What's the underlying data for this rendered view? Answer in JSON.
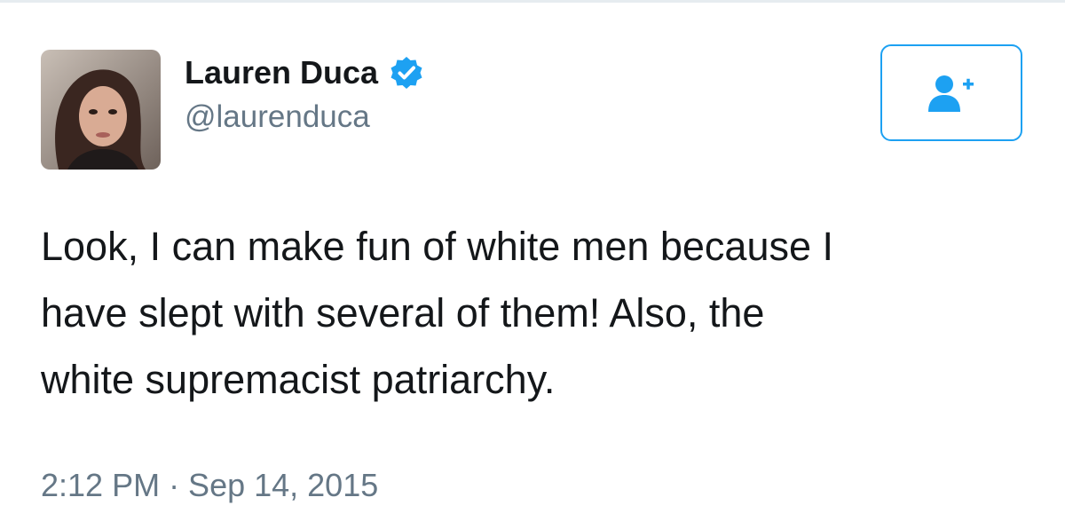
{
  "author": {
    "display_name": "Lauren Duca",
    "handle": "@laurenduca",
    "verified": true,
    "avatar_icon": "profile-photo"
  },
  "follow_button": {
    "icon": "add-user-icon",
    "accent_color": "#1da1f2"
  },
  "tweet": {
    "lines": [
      "Look, I can make fun of white men because I",
      "have slept with several of them! Also, the",
      "white supremacist patriarchy."
    ],
    "timestamp": "2:12 PM · Sep 14, 2015"
  },
  "colors": {
    "text_primary": "#14171a",
    "text_secondary": "#657786",
    "verified_blue": "#1da1f2"
  }
}
